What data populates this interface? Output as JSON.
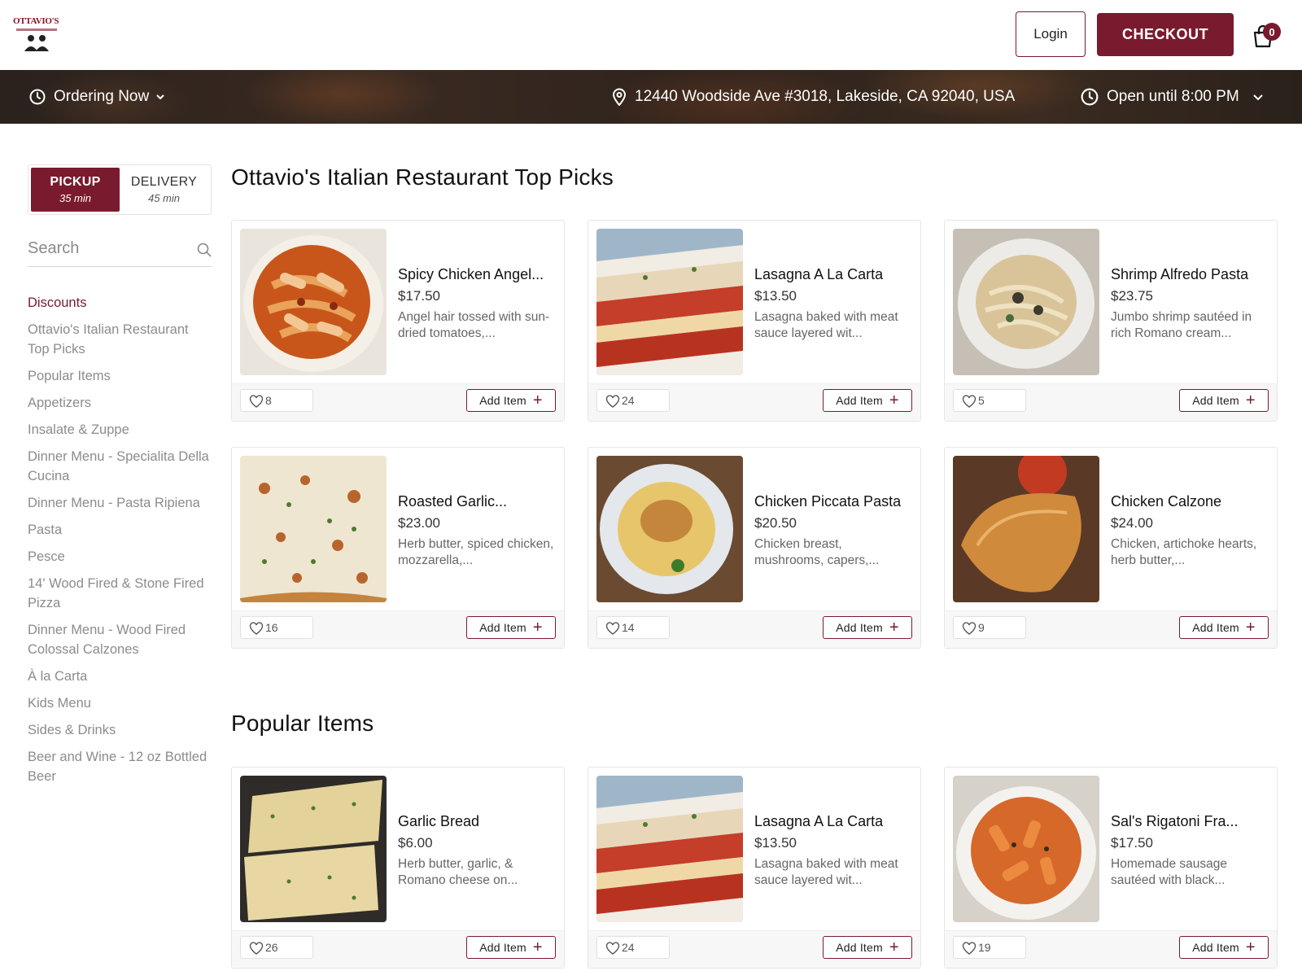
{
  "header": {
    "logo_text": "OTTAVIO'S",
    "login_label": "Login",
    "checkout_label": "CHECKOUT",
    "cart_count": "0"
  },
  "banner": {
    "ordering_label": "Ordering Now",
    "address": "12440 Woodside Ave #3018, Lakeside, CA 92040, USA",
    "hours": "Open until 8:00 PM"
  },
  "mode": {
    "pickup_label": "PICKUP",
    "pickup_time": "35 min",
    "delivery_label": "DELIVERY",
    "delivery_time": "45 min"
  },
  "search": {
    "placeholder": "Search"
  },
  "categories": [
    "Discounts",
    "Ottavio's Italian Restaurant Top Picks",
    "Popular Items",
    "Appetizers",
    "Insalate & Zuppe",
    "Dinner Menu - Specialita Della Cucina",
    "Dinner Menu - Pasta Ripiena",
    "Pasta",
    "Pesce",
    "14' Wood Fired & Stone Fired Pizza",
    "Dinner Menu - Wood Fired Colossal Calzones",
    "À la Carta",
    "Kids Menu",
    "Sides & Drinks",
    "Beer and Wine - 12 oz Bottled Beer"
  ],
  "sections": [
    {
      "title": "Ottavio's Italian Restaurant Top Picks",
      "items": [
        {
          "name": "Spicy Chicken Angel...",
          "price": "$17.50",
          "desc": "Angel hair tossed with sun-dried tomatoes,...",
          "likes": "8",
          "add_label": "Add Item"
        },
        {
          "name": "Lasagna A La Carta",
          "price": "$13.50",
          "desc": "Lasagna baked with meat sauce layered wit...",
          "likes": "24",
          "add_label": "Add Item"
        },
        {
          "name": "Shrimp Alfredo Pasta",
          "price": "$23.75",
          "desc": "Jumbo shrimp sautéed in rich Romano cream...",
          "likes": "5",
          "add_label": "Add Item"
        },
        {
          "name": "Roasted Garlic...",
          "price": "$23.00",
          "desc": "Herb butter, spiced chicken, mozzarella,...",
          "likes": "16",
          "add_label": "Add Item"
        },
        {
          "name": "Chicken Piccata Pasta",
          "price": "$20.50",
          "desc": "Chicken breast, mushrooms, capers,...",
          "likes": "14",
          "add_label": "Add Item"
        },
        {
          "name": "Chicken Calzone",
          "price": "$24.00",
          "desc": "Chicken, artichoke hearts, herb butter,...",
          "likes": "9",
          "add_label": "Add Item"
        }
      ]
    },
    {
      "title": "Popular Items",
      "items": [
        {
          "name": "Garlic Bread",
          "price": "$6.00",
          "desc": "Herb butter, garlic, & Romano cheese on...",
          "likes": "26",
          "add_label": "Add Item"
        },
        {
          "name": "Lasagna A La Carta",
          "price": "$13.50",
          "desc": "Lasagna baked with meat sauce layered wit...",
          "likes": "24",
          "add_label": "Add Item"
        },
        {
          "name": "Sal's Rigatoni Fra...",
          "price": "$17.50",
          "desc": "Homemade sausage sautéed with black...",
          "likes": "19",
          "add_label": "Add Item"
        }
      ]
    }
  ],
  "colors": {
    "brand": "#7a1a2e",
    "muted_text": "#8c8c8c"
  }
}
